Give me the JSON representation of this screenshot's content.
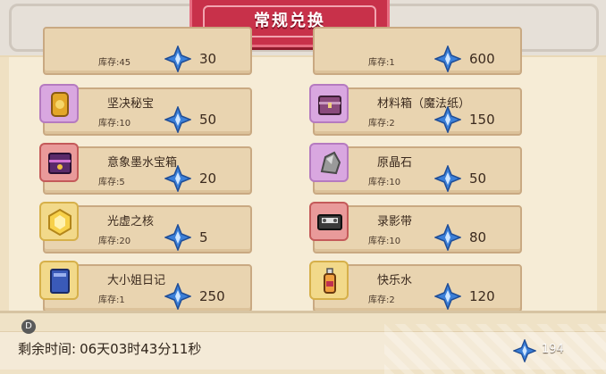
{
  "title": "常规兑换",
  "stock_prefix": "库存:",
  "items": [
    {
      "name": "",
      "stock": "库存:45",
      "price": "30",
      "icon": "partial-item-icon"
    },
    {
      "name": "",
      "stock": "库存:1",
      "price": "600",
      "icon": "partial-item-icon"
    },
    {
      "name": "坚决秘宝",
      "stock": "库存:10",
      "price": "50",
      "icon": "gold-relic-icon"
    },
    {
      "name": "材料箱（魔法纸）",
      "stock": "库存:2",
      "price": "150",
      "icon": "material-chest-icon"
    },
    {
      "name": "意象墨水宝箱",
      "stock": "库存:5",
      "price": "20",
      "icon": "ink-treasure-chest-icon"
    },
    {
      "name": "原晶石",
      "stock": "库存:10",
      "price": "50",
      "icon": "raw-crystal-icon"
    },
    {
      "name": "光虚之核",
      "stock": "库存:20",
      "price": "5",
      "icon": "light-core-icon"
    },
    {
      "name": "录影带",
      "stock": "库存:10",
      "price": "80",
      "icon": "videotape-icon"
    },
    {
      "name": "大小姐日记",
      "stock": "库存:1",
      "price": "250",
      "icon": "diary-book-icon"
    },
    {
      "name": "快乐水",
      "stock": "库存:2",
      "price": "120",
      "icon": "soda-bottle-icon"
    }
  ],
  "footer": {
    "remaining_label": "剩余时间:",
    "remaining_value": "06天03时43分11秒",
    "badge": "D",
    "currency_amount": "194",
    "currency_icon": "blue-crystal-icon"
  },
  "colors": {
    "banner": "#c8314a",
    "card": "#e9d4b0",
    "gem": "#3b7fd8"
  }
}
